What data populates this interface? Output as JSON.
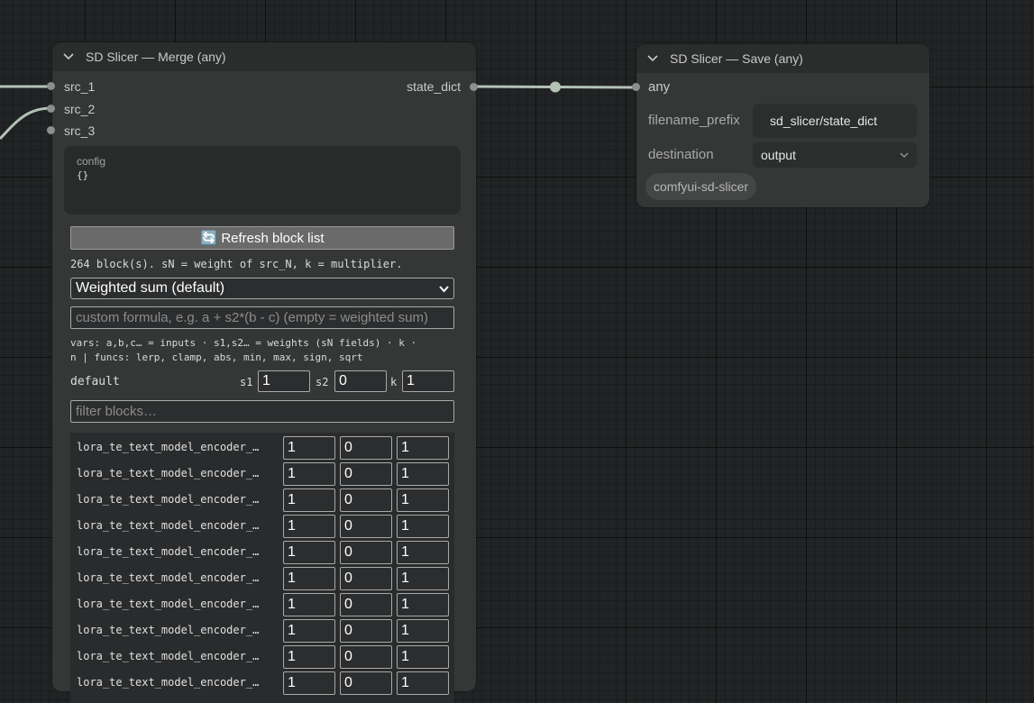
{
  "merge_node": {
    "title": "SD Slicer — Merge (any)",
    "inputs": [
      "src_1",
      "src_2",
      "src_3"
    ],
    "output": "state_dict",
    "config": {
      "label": "config",
      "value": "{}"
    },
    "refresh_label": "🔄 Refresh block list",
    "block_info": "264 block(s). sN = weight of src_N, k = multiplier.",
    "mode_selected": "Weighted sum (default)",
    "formula_placeholder": "custom formula, e.g.  a + s2*(b - c)   (empty = weighted sum)",
    "vars_help_line1": "vars: a,b,c… = inputs · s1,s2… = weights (sN fields) · k ·",
    "vars_help_line2": "n | funcs: lerp, clamp, abs, min, max, sign, sqrt",
    "default_row": {
      "label": "default",
      "s1_label": "s1",
      "s1": "1",
      "s2_label": "s2",
      "s2": "0",
      "k_label": "k",
      "k": "1"
    },
    "filter_placeholder": "filter blocks…",
    "blocks": [
      {
        "name": "lora_te_text_model_encoder_…",
        "s1": "1",
        "s2": "0",
        "k": "1"
      },
      {
        "name": "lora_te_text_model_encoder_…",
        "s1": "1",
        "s2": "0",
        "k": "1"
      },
      {
        "name": "lora_te_text_model_encoder_…",
        "s1": "1",
        "s2": "0",
        "k": "1"
      },
      {
        "name": "lora_te_text_model_encoder_…",
        "s1": "1",
        "s2": "0",
        "k": "1"
      },
      {
        "name": "lora_te_text_model_encoder_…",
        "s1": "1",
        "s2": "0",
        "k": "1"
      },
      {
        "name": "lora_te_text_model_encoder_…",
        "s1": "1",
        "s2": "0",
        "k": "1"
      },
      {
        "name": "lora_te_text_model_encoder_…",
        "s1": "1",
        "s2": "0",
        "k": "1"
      },
      {
        "name": "lora_te_text_model_encoder_…",
        "s1": "1",
        "s2": "0",
        "k": "1"
      },
      {
        "name": "lora_te_text_model_encoder_…",
        "s1": "1",
        "s2": "0",
        "k": "1"
      },
      {
        "name": "lora_te_text_model_encoder_…",
        "s1": "1",
        "s2": "0",
        "k": "1"
      }
    ]
  },
  "save_node": {
    "title": "SD Slicer — Save (any)",
    "input": "any",
    "filename_prefix": {
      "label": "filename_prefix",
      "value": "sd_slicer/state_dict"
    },
    "destination": {
      "label": "destination",
      "value": "output"
    },
    "tag": "comfyui-sd-slicer"
  },
  "colors": {
    "canvas": "#222324",
    "node_body": "#353737",
    "node_header": "#2b2d2d",
    "wire": "#b3c2b5"
  },
  "icons": [
    "chevron-down-icon",
    "refresh-icon",
    "select-caret-icon"
  ]
}
